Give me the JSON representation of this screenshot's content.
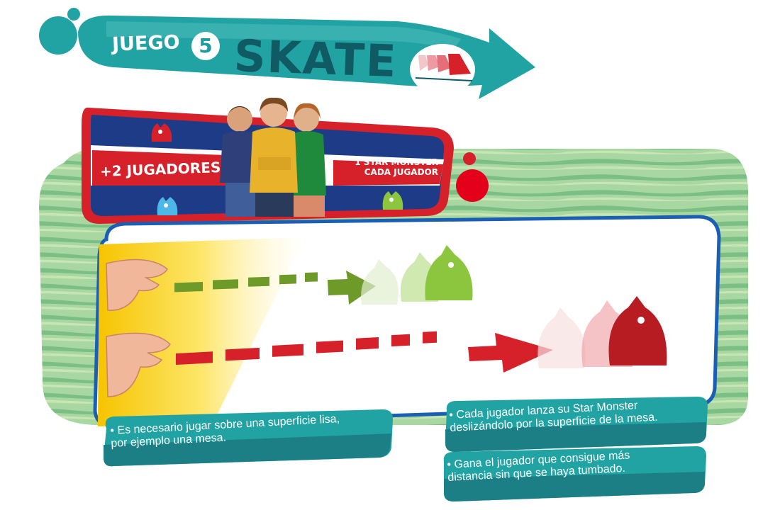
{
  "header": {
    "game_label": "JUEGO",
    "game_number": "5",
    "game_title": "SKATE"
  },
  "players": {
    "count_label": "+2 JUGADORES",
    "monster_line1": "1 STAR MONSTER",
    "monster_line2": "CADA JUGADOR"
  },
  "instructions": [
    {
      "line1": "• Es necesario jugar sobre una superficie lisa,",
      "line2": "por ejemplo una mesa."
    },
    {
      "line1": "• Cada jugador lanza su Star Monster",
      "line2": "deslizándolo por la superficie de la mesa."
    },
    {
      "line1": "• Gana el jugador que consigue más",
      "line2": "distancia sin que se haya tumbado."
    }
  ],
  "colors": {
    "teal": "#21a3a3",
    "teal_dark": "#0f5a63",
    "red": "#d6212a",
    "navy": "#1d3b87",
    "green_arrow": "#6e9a2a",
    "frame_blue": "#1a5fb4"
  },
  "icons": [
    "monster-red-icon",
    "monster-blue-icon",
    "monster-green-icon",
    "hand-icon",
    "skate-board-icon"
  ]
}
